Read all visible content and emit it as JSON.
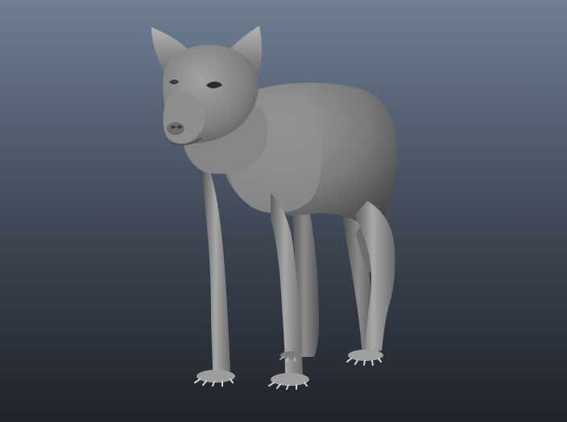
{
  "viewport": {
    "background_top": "#6e7f94",
    "background_mid": "#3e4654",
    "background_bottom": "#1f232a"
  },
  "model": {
    "subject": "wolf-mesh",
    "base_color": "#8a8a8a",
    "highlight_color": "#bcbcbc",
    "shadow_color": "#3a3a3a"
  }
}
